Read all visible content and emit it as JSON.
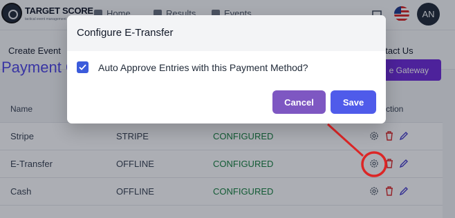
{
  "brand": {
    "name": "TARGET SCORE",
    "tagline": "tactical event management"
  },
  "topnav": {
    "links": [
      {
        "label": "Home"
      },
      {
        "label": "Results"
      },
      {
        "label": "Events"
      }
    ],
    "avatar_initials": "AN"
  },
  "subnav": {
    "left_item": "Create Event",
    "right_item": "ntact Us"
  },
  "page": {
    "title": "Payment G",
    "gateway_button": "e Gateway"
  },
  "table": {
    "headers": {
      "name": "Name",
      "action": "ction"
    },
    "rows": [
      {
        "name": "Stripe",
        "type": "STRIPE",
        "status": "CONFIGURED"
      },
      {
        "name": "E-Transfer",
        "type": "OFFLINE",
        "status": "CONFIGURED"
      },
      {
        "name": "Cash",
        "type": "OFFLINE",
        "status": "CONFIGURED"
      }
    ]
  },
  "modal": {
    "title": "Configure E-Transfer",
    "checkbox_label": "Auto Approve Entries with this Payment Method?",
    "checkbox_checked": true,
    "cancel_label": "Cancel",
    "save_label": "Save"
  },
  "colors": {
    "accent": "#4f46e5",
    "status_configured": "#15803d",
    "annotation": "#dc2626",
    "cancel_button": "#7e57c2",
    "save_button": "#4f5bea"
  },
  "icons": [
    "gear-icon",
    "trash-icon",
    "pencil-icon",
    "chat-icon",
    "us-flag-icon"
  ]
}
